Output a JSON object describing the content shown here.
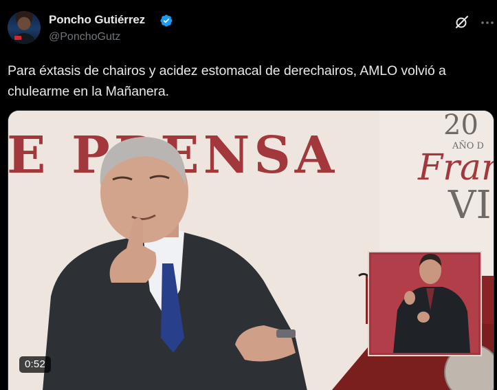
{
  "author": {
    "name": "Poncho Gutiérrez",
    "handle": "@PonchoGutz",
    "verified": true
  },
  "post": {
    "text": "Para éxtasis de chairos y acidez estomacal de derechairos, AMLO volvió a chulearme en la Mañanera."
  },
  "video": {
    "duration": "0:52",
    "backdrop_text_left": "E PRENSA",
    "backdrop_text_right_top": "20",
    "backdrop_text_right_mid": "AÑO D",
    "backdrop_text_right_franc": "Fran",
    "backdrop_text_right_vi": "VI"
  },
  "icons": {
    "avatar": "profile-photo",
    "verified": "verified-badge-icon",
    "grok": "grok-icon",
    "more": "more-options-icon"
  },
  "colors": {
    "background": "#000000",
    "text_primary": "#e7e9ea",
    "text_secondary": "#71767b",
    "verified_blue": "#1d9bf0",
    "backdrop_red": "#a2383c"
  }
}
